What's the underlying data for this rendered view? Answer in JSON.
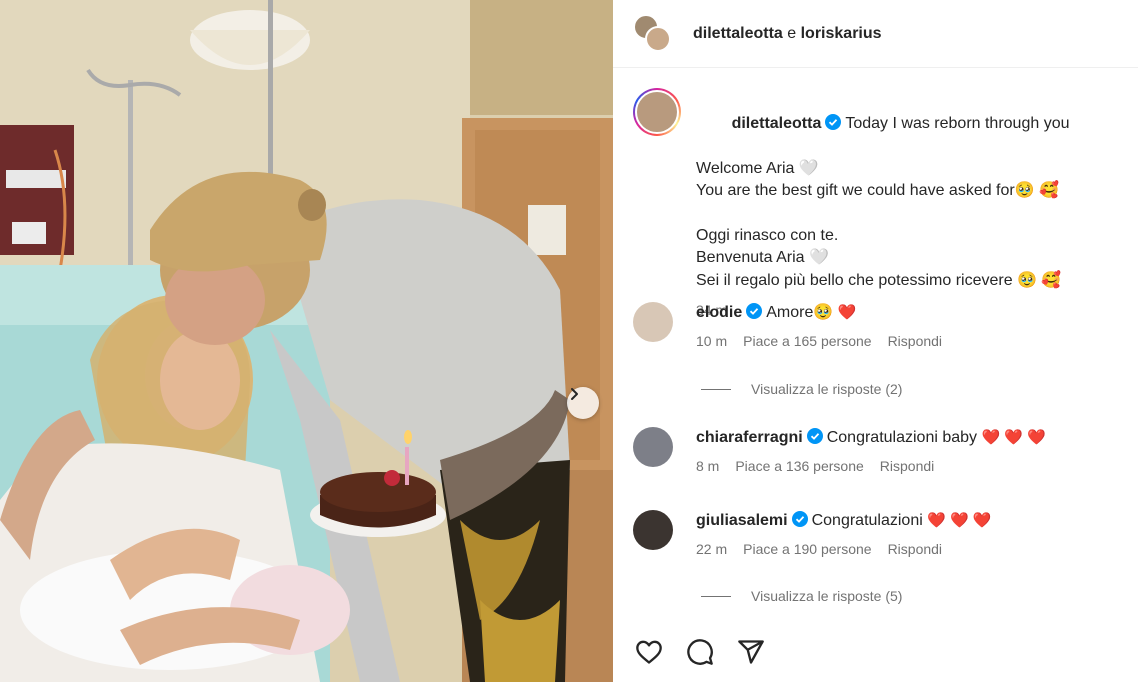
{
  "post": {
    "header": {
      "user1": "dilettaleotta",
      "joiner": "e",
      "user2": "loriskarius"
    },
    "caption": {
      "username": "dilettaleotta",
      "lines": [
        "Today I was reborn through you",
        "Welcome Aria 🤍",
        "You are the best gift we could have asked for",
        "",
        "Oggi rinasco con te.",
        "Benvenuta Aria 🤍",
        "Sei il regalo più bello che potessimo ricevere"
      ],
      "line3_emoji": "🥹 🥰",
      "line7_emoji": "🥹 🥰",
      "time": "34 m"
    },
    "comments": [
      {
        "username": "elodie",
        "text": "Amore",
        "emoji": "🥹",
        "hearts": "❤️",
        "time": "10 m",
        "likes": "Piace a 165 persone",
        "reply": "Rispondi",
        "view_replies": "Visualizza le risposte (2)"
      },
      {
        "username": "chiaraferragni",
        "text": "Congratulazioni baby",
        "hearts": "❤️ ❤️ ❤️",
        "time": "8 m",
        "likes": "Piace a 136 persone",
        "reply": "Rispondi"
      },
      {
        "username": "giuliasalemi",
        "text": "Congratulazioni",
        "hearts": "❤️ ❤️ ❤️",
        "time": "22 m",
        "likes": "Piace a 190 persone",
        "reply": "Rispondi",
        "view_replies": "Visualizza le risposte (5)"
      }
    ],
    "actions": [
      "heart-icon",
      "comment-icon",
      "share-icon"
    ],
    "colors": {
      "verified": "#0095f6",
      "muted": "#737373",
      "heart": "#ff3040"
    }
  }
}
